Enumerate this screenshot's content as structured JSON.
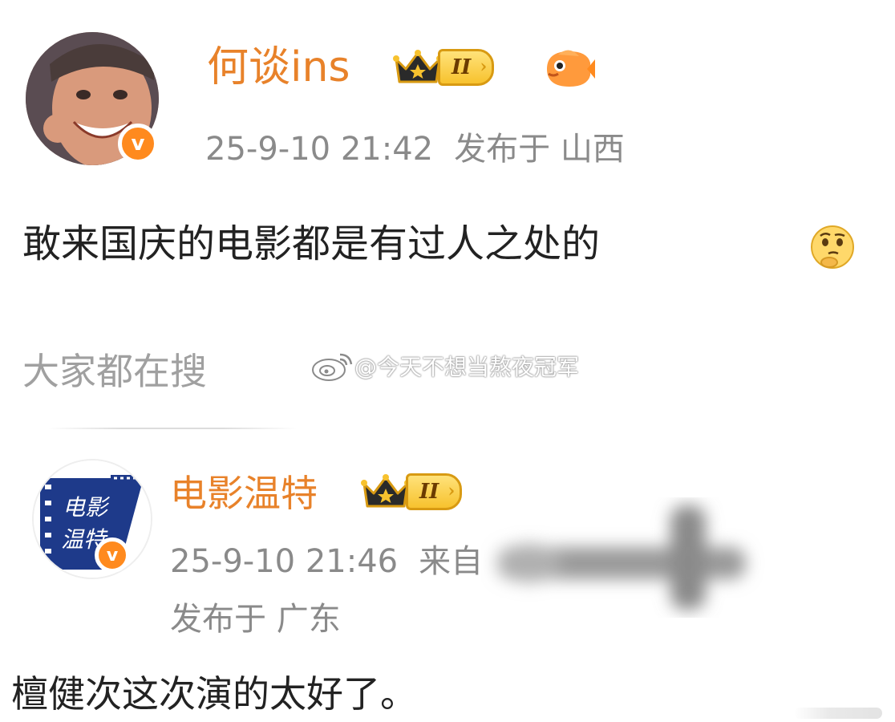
{
  "post1": {
    "username": "何谈ins",
    "level_badge": "II",
    "timestamp": "25-9-10 21:42",
    "location": "发布于 山西",
    "content": "敢来国庆的电影都是有过人之处的",
    "icons": [
      "crown-icon",
      "fish-icon",
      "verified-icon",
      "thinking-emoji-icon"
    ]
  },
  "search_section": {
    "title": "大家都在搜"
  },
  "watermark": {
    "text": "@今天不想当熬夜冠军"
  },
  "post2": {
    "username": "电影温特",
    "level_badge": "II",
    "timestamp": "25-9-10 21:46",
    "source": "来自",
    "location": "发布于 广东",
    "content": "檀健次这次演的太好了。",
    "avatar_text_1": "电影",
    "avatar_text_2": "温特",
    "icons": [
      "crown-icon",
      "verified-icon"
    ]
  },
  "colors": {
    "username": "#e8822a",
    "meta": "#8a8a8a",
    "badge_gold": "#f7c22e",
    "verified_orange": "#ff8a1e",
    "avatar2_blue": "#1e3a8a"
  }
}
